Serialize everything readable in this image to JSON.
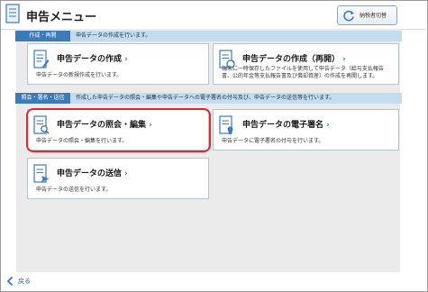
{
  "header": {
    "title": "申告メニュー",
    "switch_button_label": "納税者切替",
    "switch_icon": "refresh-icon"
  },
  "sections": [
    {
      "tag": "作成・再開",
      "description": "申告データの作成を行います。"
    },
    {
      "tag": "照会・署名・送信",
      "description": "作成した申告データの照会・編集や申告データへの電子署名の付与及び、申告データの送信等を行います。"
    }
  ],
  "cards": {
    "create": {
      "title": "申告データの作成",
      "description": "申告データの新規作成を行います。",
      "icon": "document-edit-icon"
    },
    "resume": {
      "title": "申告データの作成（再開）",
      "description_line1": "端末に一時保存したファイルを使用して申告データ（給与支払報告",
      "description_line2": "書、公的年金等支払報告書及び償却資産）の作成を再開します。",
      "icon": "document-resume-icon"
    },
    "view_edit": {
      "title": "申告データの照会・編集",
      "description": "申告データの照会・編集を行います。",
      "icon": "document-search-icon"
    },
    "signature": {
      "title": "申告データの電子署名",
      "description": "申告データに電子署名の付与を行います。",
      "icon": "document-sign-icon"
    },
    "send": {
      "title": "申告データの送信",
      "description": "申告データの送信を行います。",
      "icon": "document-send-icon"
    }
  },
  "footer": {
    "back_label": "戻る",
    "back_icon": "chevron-left-icon"
  },
  "colors": {
    "section_tag": "#3c7bb8",
    "section_bar": "#c5dcef",
    "highlight": "#e4272f",
    "chevron": "#3a7abf"
  }
}
